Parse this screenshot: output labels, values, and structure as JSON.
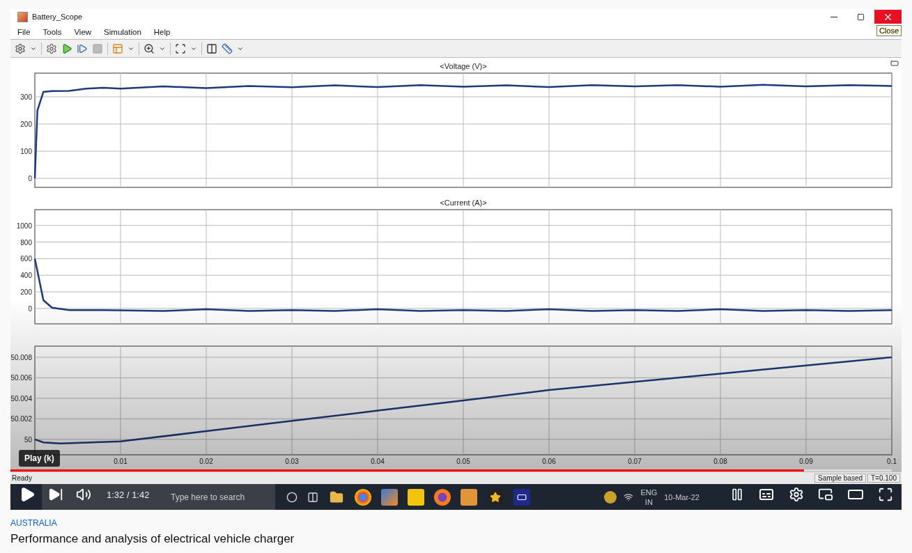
{
  "video": {
    "window": {
      "title": "Battery_Scope",
      "close_tooltip": "Close"
    },
    "menu": [
      "File",
      "Tools",
      "View",
      "Simulation",
      "Help"
    ],
    "plots": [
      {
        "title": "<Voltage (V)>",
        "chart_data": {
          "type": "line",
          "grid": true,
          "xlim": [
            0,
            0.1
          ],
          "ylim": [
            -33,
            387
          ],
          "yticks": [
            0,
            100,
            200,
            300
          ],
          "x": [
            0,
            0.0003,
            0.001,
            0.002,
            0.004,
            0.006,
            0.008,
            0.01,
            0.015,
            0.02,
            0.025,
            0.03,
            0.035,
            0.04,
            0.045,
            0.05,
            0.055,
            0.06,
            0.065,
            0.07,
            0.075,
            0.08,
            0.085,
            0.09,
            0.095,
            0.1
          ],
          "series": [
            {
              "color": "#1f3a7a",
              "values": [
                0,
                250,
                318,
                321,
                322,
                330,
                333,
                330,
                338,
                332,
                340,
                335,
                342,
                336,
                343,
                337,
                342,
                336,
                343,
                338,
                343,
                337,
                344,
                338,
                343,
                340
              ]
            }
          ]
        }
      },
      {
        "title": "<Current (A)>",
        "chart_data": {
          "type": "line",
          "grid": true,
          "xlim": [
            0,
            0.1
          ],
          "ylim": [
            -185,
            1190
          ],
          "yticks": [
            0,
            200,
            400,
            600,
            800,
            1000
          ],
          "x": [
            0,
            0.0003,
            0.001,
            0.002,
            0.004,
            0.008,
            0.015,
            0.02,
            0.025,
            0.03,
            0.035,
            0.04,
            0.045,
            0.05,
            0.055,
            0.06,
            0.065,
            0.07,
            0.075,
            0.08,
            0.085,
            0.09,
            0.095,
            0.1
          ],
          "series": [
            {
              "color": "#1f3a7a",
              "values": [
                600,
                450,
                100,
                10,
                -20,
                -20,
                -30,
                -10,
                -30,
                -20,
                -30,
                -10,
                -30,
                -20,
                -30,
                -10,
                -30,
                -20,
                -30,
                -10,
                -30,
                -20,
                -30,
                -20
              ]
            }
          ]
        }
      },
      {
        "chart_data": {
          "type": "line",
          "grid": true,
          "xlim": [
            0,
            0.1
          ],
          "ylim": [
            49.9985,
            50.00908
          ],
          "yticks": [
            50,
            50.002,
            50.004,
            50.006,
            50.008
          ],
          "xticks": [
            0.01,
            0.02,
            0.03,
            0.04,
            0.05,
            0.06,
            0.07,
            0.08,
            0.09,
            0.1
          ],
          "x": [
            0,
            0.001,
            0.003,
            0.01,
            0.02,
            0.03,
            0.04,
            0.05,
            0.06,
            0.07,
            0.08,
            0.09,
            0.1
          ],
          "series": [
            {
              "color": "#1f3a7a",
              "values": [
                50,
                49.9997,
                49.9996,
                49.9998,
                50.0008,
                50.0018,
                50.0028,
                50.0038,
                50.0048,
                50.0056,
                50.0064,
                50.0072,
                50.008
              ]
            }
          ]
        }
      }
    ],
    "status_bar": {
      "status": "Ready",
      "mode": "Sample based",
      "time": "T=0.100"
    },
    "taskbar": {
      "search_placeholder": "Type here to search",
      "language": "ENG",
      "region": "IN",
      "date": "10-Mar-22"
    },
    "player": {
      "tooltip": "Play (k)",
      "time": "1:32 / 1:42",
      "progress": {
        "level": 0.9
      }
    }
  },
  "channel": "AUSTRALIA",
  "title": "Performance and analysis of electrical vehicle charger"
}
